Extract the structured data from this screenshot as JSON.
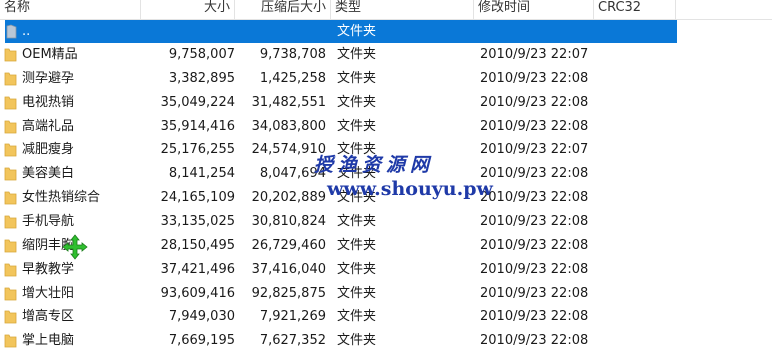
{
  "columns": {
    "name": "名称",
    "size": "大小",
    "packed": "压缩后大小",
    "type": "类型",
    "modified": "修改时间",
    "crc": "CRC32"
  },
  "parent_row": {
    "name": "..",
    "type": "文件夹"
  },
  "rows": [
    {
      "name": "OEM精品",
      "size": "9,758,007",
      "packed": "9,738,708",
      "type": "文件夹",
      "modified": "2010/9/23 22:07"
    },
    {
      "name": "测孕避孕",
      "size": "3,382,895",
      "packed": "1,425,258",
      "type": "文件夹",
      "modified": "2010/9/23 22:08"
    },
    {
      "name": "电视热销",
      "size": "35,049,224",
      "packed": "31,482,551",
      "type": "文件夹",
      "modified": "2010/9/23 22:08"
    },
    {
      "name": "高端礼品",
      "size": "35,914,416",
      "packed": "34,083,800",
      "type": "文件夹",
      "modified": "2010/9/23 22:08"
    },
    {
      "name": "减肥瘦身",
      "size": "25,176,255",
      "packed": "24,574,910",
      "type": "文件夹",
      "modified": "2010/9/23 22:07"
    },
    {
      "name": "美容美白",
      "size": "8,141,254",
      "packed": "8,047,694",
      "type": "文件夹",
      "modified": "2010/9/23 22:08"
    },
    {
      "name": "女性热销综合",
      "size": "24,165,109",
      "packed": "20,202,889",
      "type": "文件夹",
      "modified": "2010/9/23 22:08"
    },
    {
      "name": "手机导航",
      "size": "33,135,025",
      "packed": "30,810,824",
      "type": "文件夹",
      "modified": "2010/9/23 22:08"
    },
    {
      "name": "缩阴丰胸",
      "size": "28,150,495",
      "packed": "26,729,460",
      "type": "文件夹",
      "modified": "2010/9/23 22:08"
    },
    {
      "name": "早教教学",
      "size": "37,421,496",
      "packed": "37,416,040",
      "type": "文件夹",
      "modified": "2010/9/23 22:08"
    },
    {
      "name": "增大壮阳",
      "size": "93,609,416",
      "packed": "92,825,875",
      "type": "文件夹",
      "modified": "2010/9/23 22:08"
    },
    {
      "name": "增高专区",
      "size": "7,949,030",
      "packed": "7,921,269",
      "type": "文件夹",
      "modified": "2010/9/23 22:08"
    },
    {
      "name": "掌上电脑",
      "size": "7,669,195",
      "packed": "7,627,352",
      "type": "文件夹",
      "modified": "2010/9/23 22:08"
    }
  ],
  "watermark": {
    "site_name": "授渔资源网",
    "url": "www.shouyu.pw"
  },
  "colors": {
    "selection": "#0a78d7",
    "folder": "#f2c55c",
    "watermark": "#1f3aa8",
    "cursor": "#2fbf2f"
  },
  "icons": {
    "folder": "folder-icon",
    "parent": "parent-folder-icon",
    "cursor": "move-cursor-icon"
  }
}
